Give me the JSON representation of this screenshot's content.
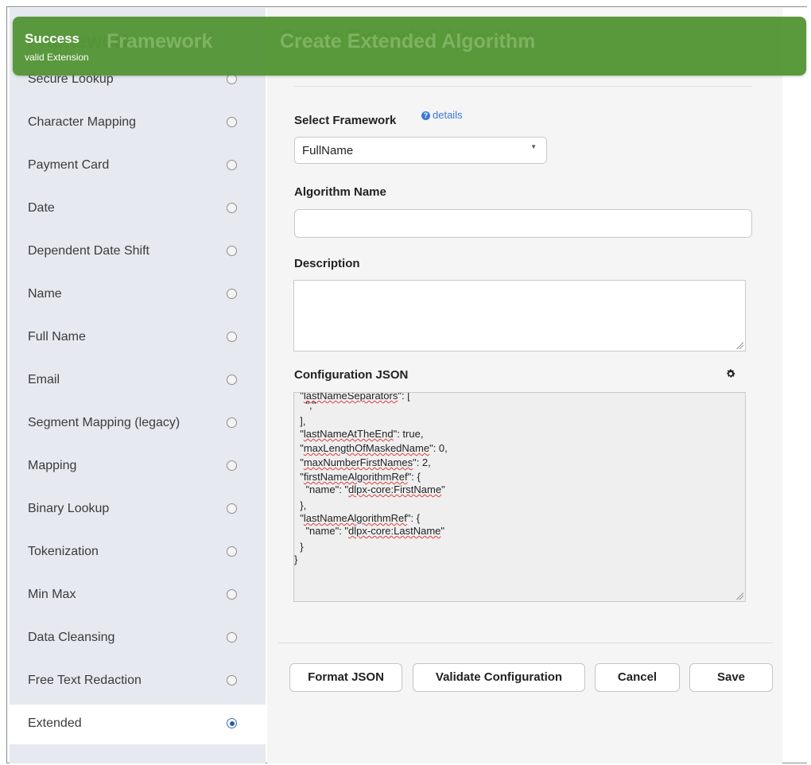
{
  "notification": {
    "title": "Success",
    "message": "valid Extension"
  },
  "sidebar": {
    "title": "Framework",
    "items": [
      {
        "label": "Secure Lookup",
        "selected": false
      },
      {
        "label": "Character Mapping",
        "selected": false
      },
      {
        "label": "Payment Card",
        "selected": false
      },
      {
        "label": "Date",
        "selected": false
      },
      {
        "label": "Dependent Date Shift",
        "selected": false
      },
      {
        "label": "Name",
        "selected": false
      },
      {
        "label": "Full Name",
        "selected": false
      },
      {
        "label": "Email",
        "selected": false
      },
      {
        "label": "Segment Mapping (legacy)",
        "selected": false
      },
      {
        "label": "Mapping",
        "selected": false
      },
      {
        "label": "Binary Lookup",
        "selected": false
      },
      {
        "label": "Tokenization",
        "selected": false
      },
      {
        "label": "Min Max",
        "selected": false
      },
      {
        "label": "Data Cleansing",
        "selected": false
      },
      {
        "label": "Free Text Redaction",
        "selected": false
      },
      {
        "label": "Extended",
        "selected": true
      }
    ]
  },
  "main": {
    "title": "Create Extended Algorithm",
    "select_framework": {
      "label": "Select Framework",
      "details_link": "details",
      "value": "FullName"
    },
    "algorithm_name": {
      "label": "Algorithm Name",
      "value": ""
    },
    "description": {
      "label": "Description",
      "value": ""
    },
    "config": {
      "label": "Configuration JSON",
      "lines": [
        "  \"lastNameSeparators\": [",
        "    \",\"",
        "  ],",
        "  \"lastNameAtTheEnd\": true,",
        "  \"maxLengthOfMaskedName\": 0,",
        "  \"maxNumberFirstNames\": 2,",
        "  \"firstNameAlgorithmRef\": {",
        "    \"name\": \"dlpx-core:FirstName\"",
        "  },",
        "  \"lastNameAlgorithmRef\": {",
        "    \"name\": \"dlpx-core:LastName\"",
        "  }",
        "}"
      ]
    },
    "buttons": {
      "format_json": "Format JSON",
      "validate": "Validate Configuration",
      "cancel": "Cancel",
      "save": "Save"
    }
  },
  "colors": {
    "toast_green": "#4f922f",
    "accent_blue": "#3a78d6",
    "sidebar_bg": "#e6e9ef"
  }
}
